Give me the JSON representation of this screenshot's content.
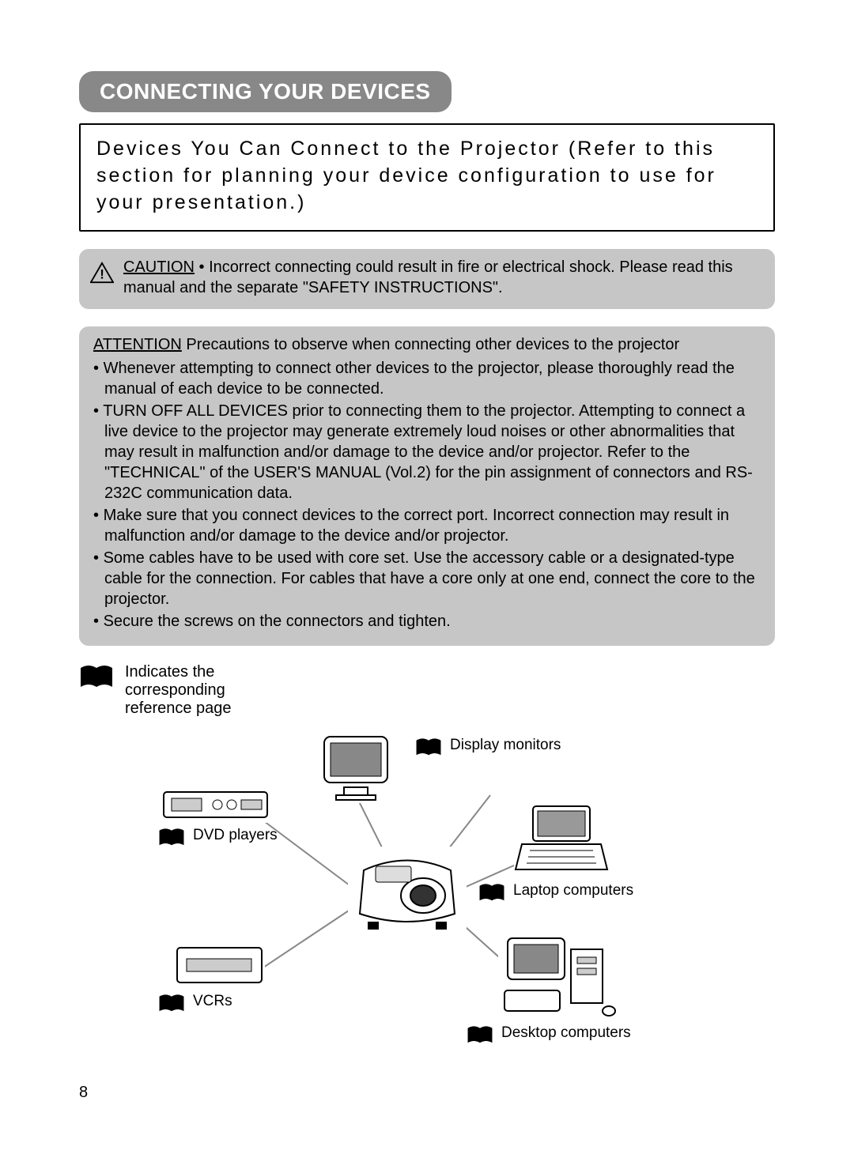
{
  "title": "CONNECTING YOUR DEVICES",
  "intro": "Devices You Can Connect to the Projector (Refer to this section for planning your device configuration to use for your presentation.)",
  "caution": {
    "label": "CAUTION",
    "text": " • Incorrect connecting could result in fire or electrical shock. Please read this manual and the separate \"SAFETY INSTRUCTIONS\"."
  },
  "attention": {
    "label": "ATTENTION",
    "intro": "   Precautions to observe when connecting other devices to the projector",
    "items": [
      "Whenever attempting to connect other devices to the projector, please thoroughly read the manual of each device to be connected.",
      "TURN OFF ALL DEVICES prior to connecting them to the projector. Attempting to connect a live device to the projector may generate extremely loud noises or other abnormalities that may result in malfunction and/or damage to the device and/or projector. Refer to the \"TECHNICAL\" of the USER'S MANUAL (Vol.2) for the pin assignment of connectors and RS-232C communication data.",
      "Make sure that you connect devices to the correct port. Incorrect connection may result in malfunction and/or damage to the device and/or projector.",
      "Some cables have to be used with core set. Use the accessory cable or a designated-type cable for the connection. For cables that have a core only at one end, connect the core to the projector.",
      "Secure the screws on the connectors and tighten."
    ]
  },
  "legend": "Indicates the corresponding reference page",
  "devices": {
    "display_monitors": "Display monitors",
    "dvd_players": "DVD players",
    "laptop_computers": "Laptop computers",
    "vcrs": "VCRs",
    "desktop_computers": "Desktop computers"
  },
  "page_number": "8"
}
